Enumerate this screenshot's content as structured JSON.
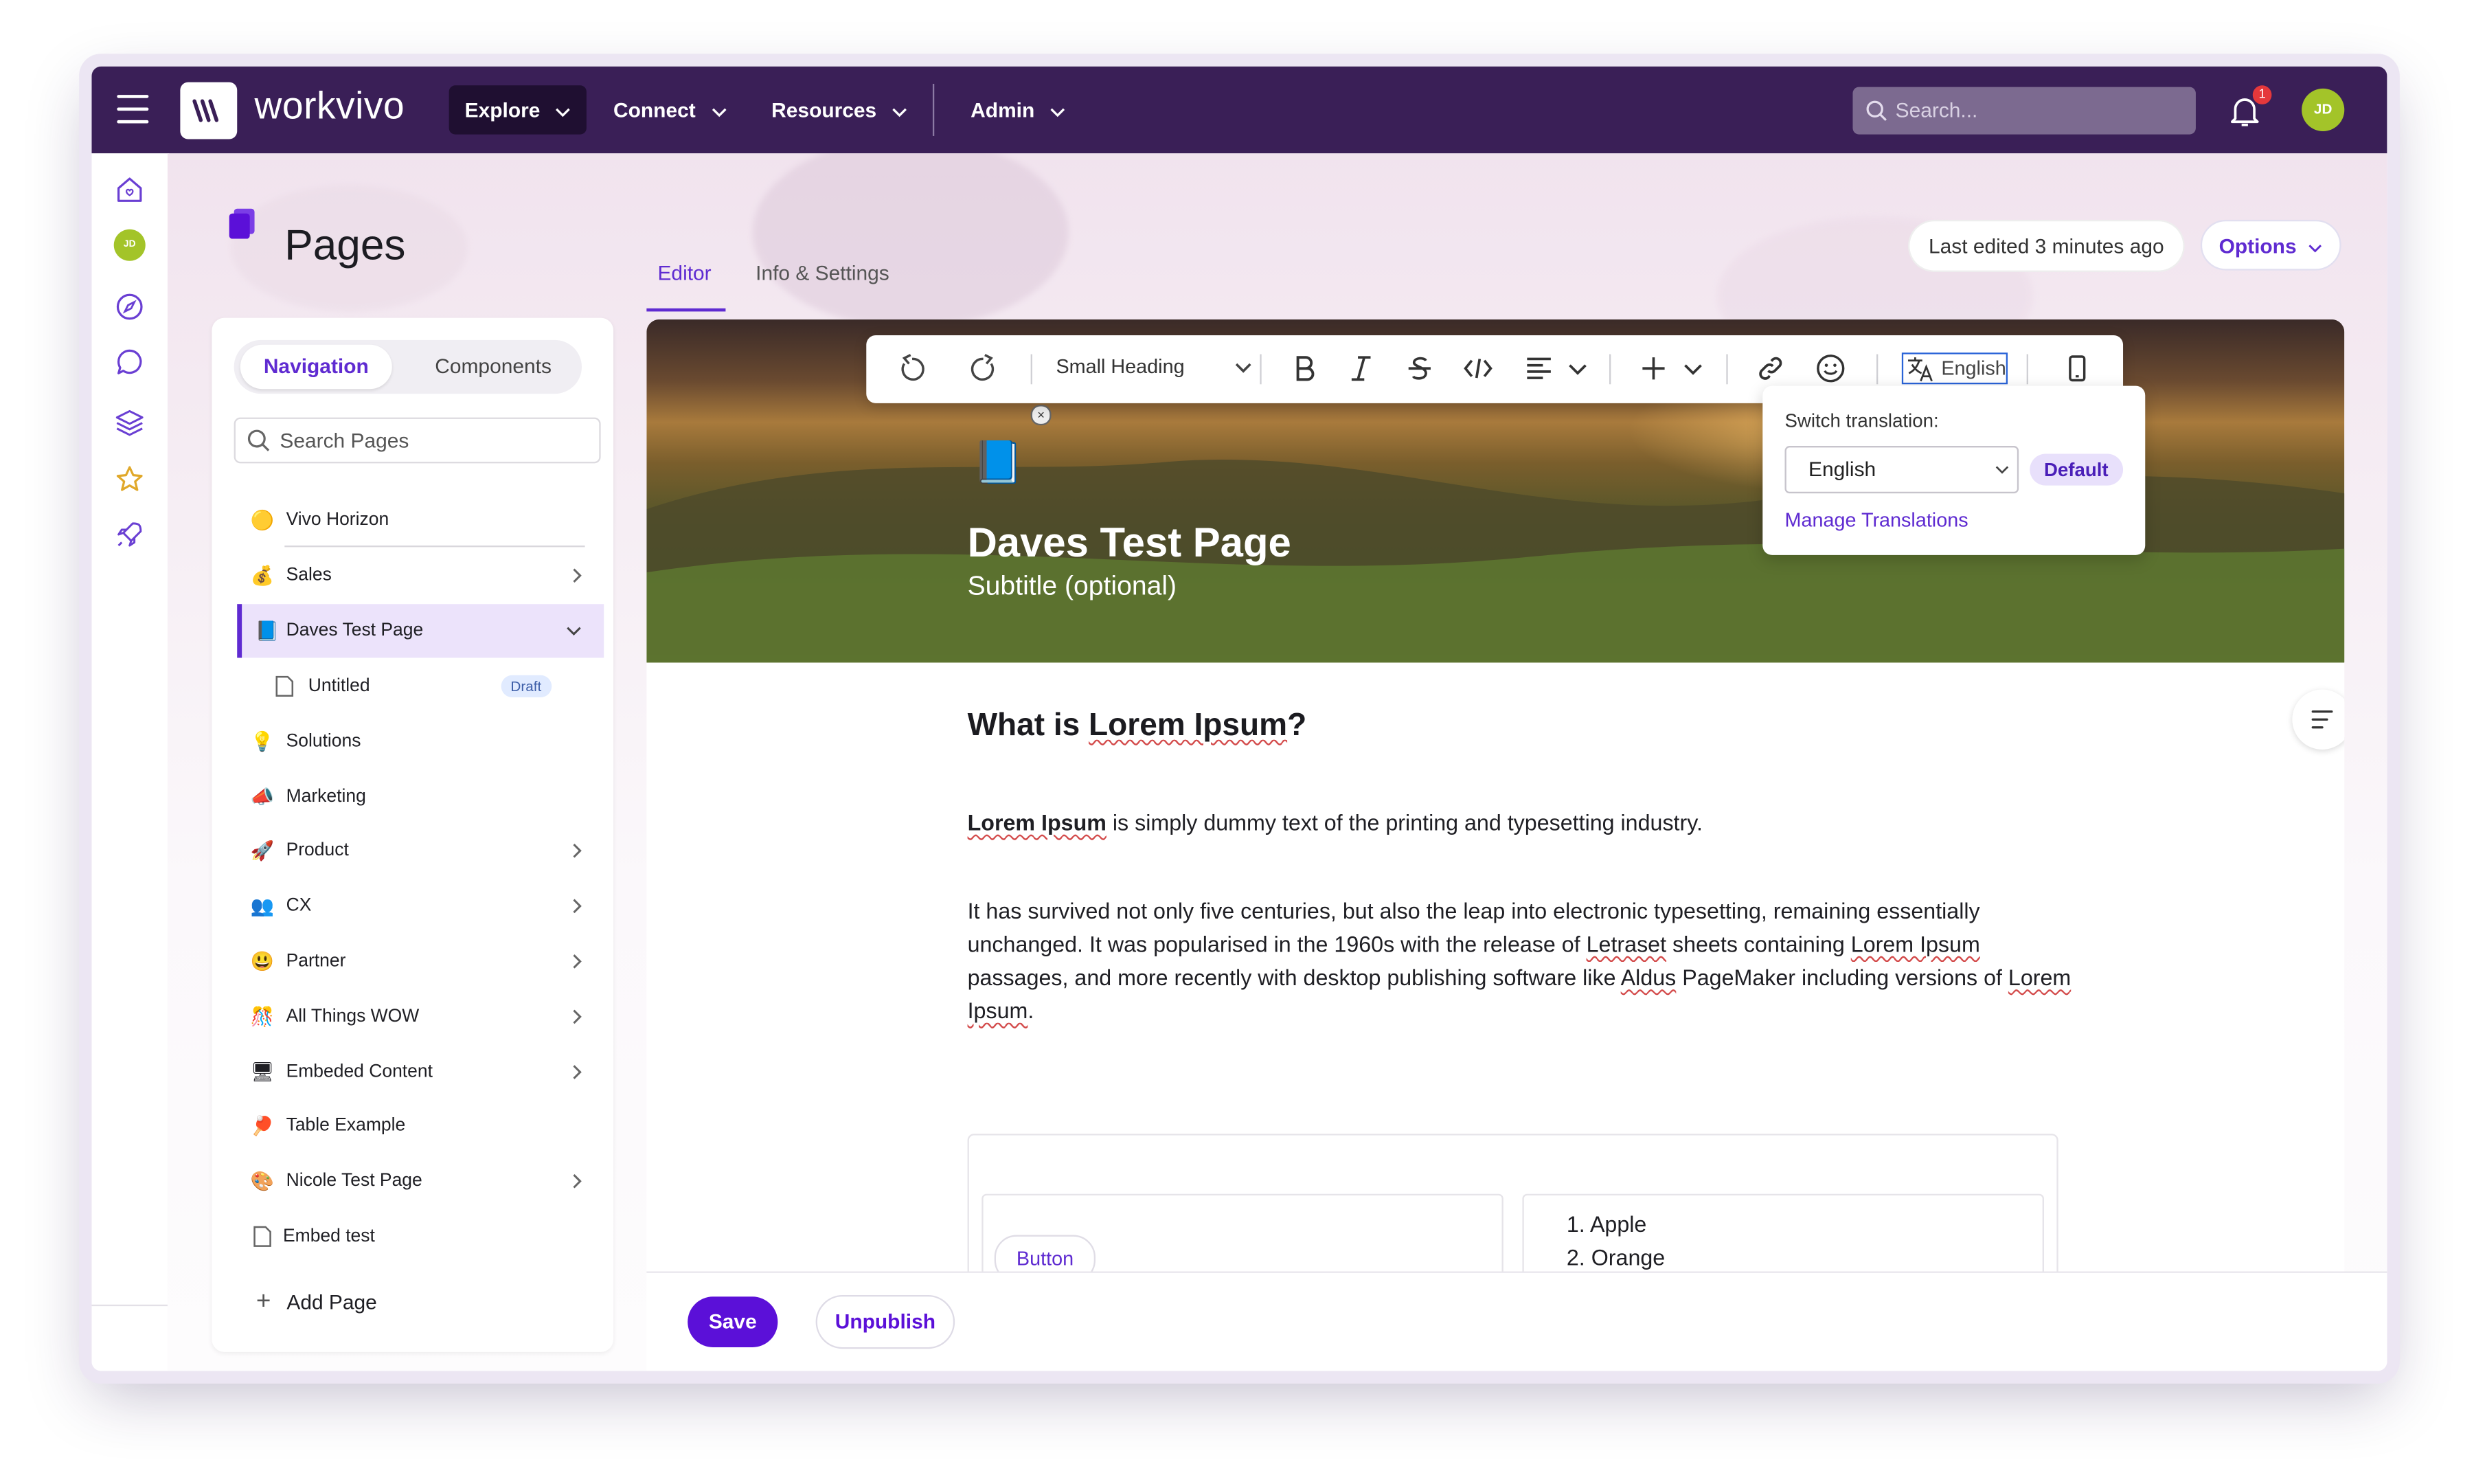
{
  "topbar": {
    "brand": "workvivo",
    "nav": [
      {
        "label": "Explore"
      },
      {
        "label": "Connect"
      },
      {
        "label": "Resources"
      },
      {
        "label": "Admin"
      }
    ],
    "search_placeholder": "Search...",
    "notification_count": "1",
    "user_initials": "JD"
  },
  "rail": {
    "user_initials": "JD",
    "icons": [
      "home-icon",
      "compass-icon",
      "chat-icon",
      "layers-icon",
      "star-icon",
      "rocket-icon"
    ]
  },
  "page": {
    "title": "Pages",
    "tabs": [
      {
        "label": "Editor"
      },
      {
        "label": "Info & Settings"
      }
    ],
    "last_edited": "Last edited 3 minutes ago",
    "options_label": "Options"
  },
  "sidebar": {
    "segments": [
      {
        "label": "Navigation"
      },
      {
        "label": "Components"
      }
    ],
    "search_placeholder": "Search Pages",
    "items": [
      {
        "emoji": "🟡",
        "label": "Vivo Horizon"
      },
      {
        "emoji": "💰",
        "label": "Sales"
      },
      {
        "emoji": "📘",
        "label": "Daves Test Page"
      },
      {
        "emoji": "📄",
        "label": "Untitled",
        "badge": "Draft"
      },
      {
        "emoji": "💡",
        "label": "Solutions"
      },
      {
        "emoji": "📣",
        "label": "Marketing"
      },
      {
        "emoji": "🚀",
        "label": "Product"
      },
      {
        "emoji": "👥",
        "label": "CX"
      },
      {
        "emoji": "😃",
        "label": "Partner"
      },
      {
        "emoji": "🎊",
        "label": "All Things WOW"
      },
      {
        "emoji": "🖥",
        "label": "Embeded Content"
      },
      {
        "emoji": "🏓",
        "label": "Table Example"
      },
      {
        "emoji": "🎨",
        "label": "Nicole Test Page"
      },
      {
        "emoji": "📄",
        "label": "Embed test"
      }
    ],
    "add_page": "Add Page"
  },
  "toolbar": {
    "text_style": "Small Heading",
    "language": "English"
  },
  "translation_popover": {
    "label": "Switch translation:",
    "selected": "English",
    "default_badge": "Default",
    "manage_link": "Manage Translations"
  },
  "document": {
    "emoji": "📘",
    "title": "Daves Test Page",
    "subtitle": "Subtitle (optional)",
    "heading_pre": "What is ",
    "heading_word": "Lorem Ipsum",
    "heading_post": "?",
    "p1_bold": "Lorem Ipsum",
    "p1_rest": " is simply dummy text of the printing and typesetting industry.",
    "p2_a": "It has survived not only five centuries, but also the leap into electronic typesetting, remaining essentially unchanged. It was popularised in the 1960s with the release of ",
    "p2_w1": "Letraset",
    "p2_b": " sheets containing ",
    "p2_w2": "Lorem Ipsum",
    "p2_c": " passages, and more recently with desktop publishing software like ",
    "p2_w3": "Aldus",
    "p2_d": " PageMaker including versions of ",
    "p2_w4": "Lorem Ipsum",
    "p2_e": ".",
    "cell_button": "Button",
    "list": [
      "Apple",
      "Orange"
    ]
  },
  "footer": {
    "save": "Save",
    "unpublish": "Unpublish"
  },
  "colors": {
    "nav_bg": "#3a1f57",
    "accent": "#5f2bd1",
    "save_bg": "#5b10d8"
  }
}
